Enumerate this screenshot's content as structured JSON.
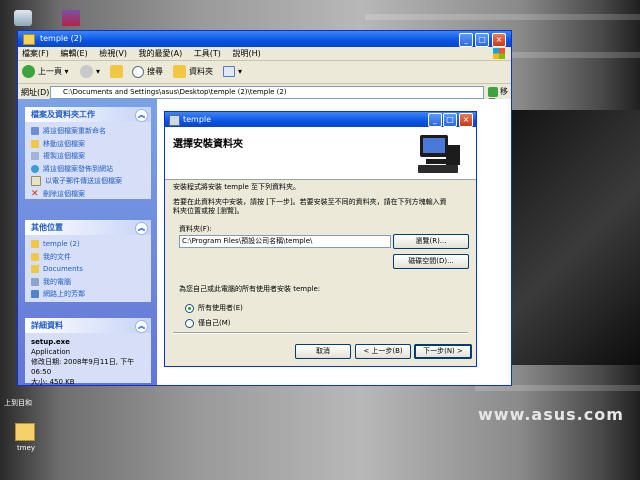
{
  "desktop": {
    "brand_text": "www.asus.com",
    "icon_label_bottom": "tmey",
    "icon_label_mid": "上到目和"
  },
  "explorer": {
    "title": "temple (2)",
    "menu": [
      "檔案(F)",
      "編輯(E)",
      "檢視(V)",
      "我的最愛(A)",
      "工具(T)",
      "說明(H)"
    ],
    "toolbar": {
      "back": "上一頁",
      "search": "搜尋",
      "folders": "資料夾"
    },
    "address": {
      "label": "網址(D)",
      "value": "C:\\Documents and Settings\\asus\\Desktop\\temple (2)\\temple (2)",
      "go": "移至"
    },
    "tasks": {
      "title": "檔案及資料夾工作",
      "items": [
        "將這個檔案重新命名",
        "移動這個檔案",
        "複製這個檔案",
        "將這個檔案發佈到網站",
        "以電子郵件傳送這個檔案",
        "刪除這個檔案"
      ]
    },
    "places": {
      "title": "其他位置",
      "items": [
        "temple (2)",
        "我的文件",
        "Documents",
        "我的電腦",
        "網路上的芳鄰"
      ]
    },
    "details": {
      "title": "詳細資料",
      "filename": "setup.exe",
      "type": "Application",
      "modified": "修改日期: 2008年9月11日, 下午 06:50",
      "size": "大小: 450 KB"
    }
  },
  "dialog": {
    "title": "temple",
    "heading": "選擇安裝資料夾",
    "intro": "安裝程式將安裝 temple 至下列資料夾。",
    "instructions_1": "若要在此資料夾中安裝，請按 [下一步]。若要安裝至不同的資料夾，請在下列方塊輸入資",
    "instructions_2": "料夾位置或按 [瀏覽]。",
    "folder_label": "資料夾(F):",
    "folder_value": "C:\\Program Files\\預設公司名稱\\temple\\",
    "browse_button": "瀏覽(R)...",
    "disk_cost_button": "磁碟空間(D)...",
    "install_for": "為您自己或此電腦的所有使用者安裝 temple:",
    "radio_everyone": "所有使用者(E)",
    "radio_just_me": "僅自己(M)",
    "cancel_button": "取消",
    "back_button": "< 上一步(B)",
    "next_button": "下一步(N) >"
  }
}
